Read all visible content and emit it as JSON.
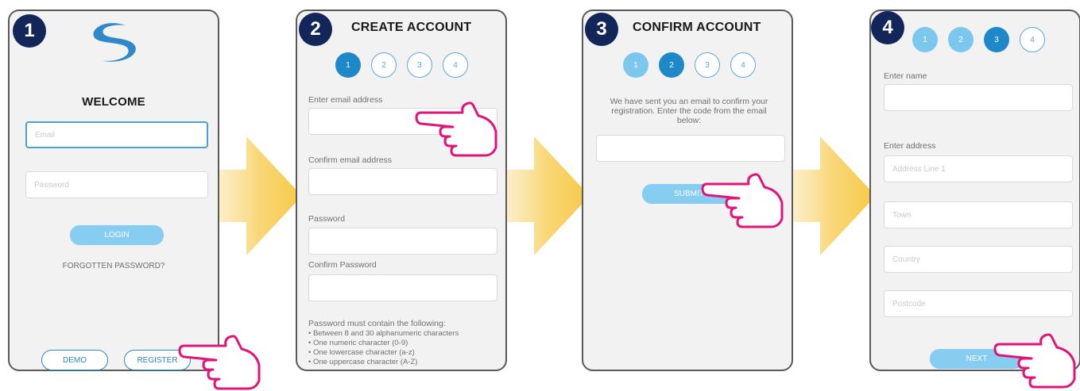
{
  "panel1": {
    "badge": "1",
    "title": "WELCOME",
    "email_placeholder": "Email",
    "password_placeholder": "Password",
    "login_label": "LOGIN",
    "forgot_label": "FORGOTTEN PASSWORD?",
    "demo_label": "DEMO",
    "register_label": "REGISTER"
  },
  "panel2": {
    "badge": "2",
    "title": "CREATE ACCOUNT",
    "steps": [
      "1",
      "2",
      "3",
      "4"
    ],
    "email_label": "Enter email address",
    "confirm_email_label": "Confirm email address",
    "password_label": "Password",
    "confirm_password_label": "Confirm Password",
    "rules_heading": "Password must contain the following:",
    "rules": [
      "• Between 8 and 30 alphanumeric characters",
      "• One numeric character (0-9)",
      "• One lowercase character (a-z)",
      "• One uppercase character (A-Z)"
    ]
  },
  "panel3": {
    "badge": "3",
    "title": "CONFIRM ACCOUNT",
    "steps": [
      "1",
      "2",
      "3",
      "4"
    ],
    "message": "We have sent you an email to confirm your registration. Enter the code from the email below:",
    "submit_label": "SUBMIT"
  },
  "panel4": {
    "badge": "4",
    "steps": [
      "1",
      "2",
      "3",
      "4"
    ],
    "name_label": "Enter name",
    "address_label": "Enter address",
    "address_line_placeholder": "Address Line 1",
    "town_placeholder": "Town",
    "country_placeholder": "Country",
    "postcode_placeholder": "Postcode",
    "next_label": "NEXT"
  },
  "colors": {
    "badge": "#12265a",
    "step_active": "#1e88c9",
    "step_done": "#7cc7ee",
    "button": "#86cdf1",
    "hand_outline": "#e0157a",
    "arrow": "#f7c948"
  }
}
